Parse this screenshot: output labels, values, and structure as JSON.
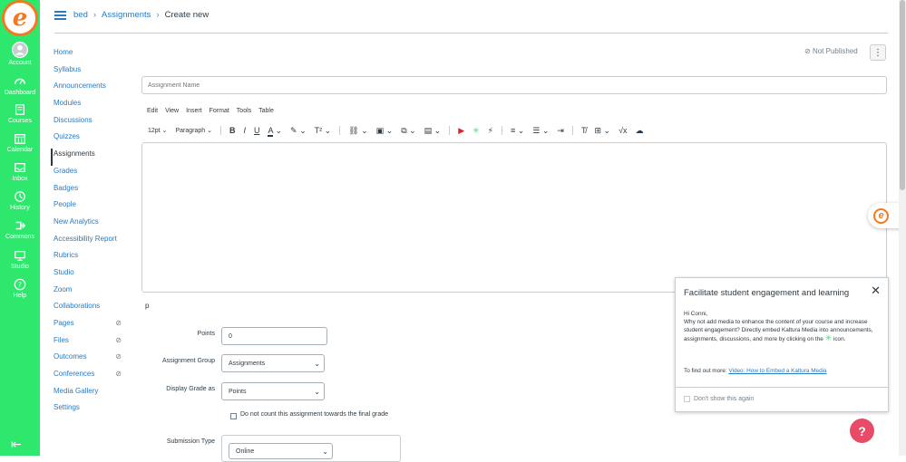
{
  "global_nav": [
    {
      "label": "Account",
      "icon": "account-icon"
    },
    {
      "label": "Dashboard",
      "icon": "dashboard-icon"
    },
    {
      "label": "Courses",
      "icon": "courses-icon"
    },
    {
      "label": "Calendar",
      "icon": "calendar-icon"
    },
    {
      "label": "Inbox",
      "icon": "inbox-icon"
    },
    {
      "label": "History",
      "icon": "history-icon"
    },
    {
      "label": "Commons",
      "icon": "commons-icon"
    },
    {
      "label": "Studio",
      "icon": "studio-icon"
    },
    {
      "label": "Help",
      "icon": "help-icon"
    }
  ],
  "breadcrumb": {
    "course": "bed",
    "section": "Assignments",
    "current": "Create new"
  },
  "course_nav": [
    {
      "label": "Home"
    },
    {
      "label": "Syllabus"
    },
    {
      "label": "Announcements"
    },
    {
      "label": "Modules"
    },
    {
      "label": "Discussions"
    },
    {
      "label": "Quizzes"
    },
    {
      "label": "Assignments",
      "active": true
    },
    {
      "label": "Grades"
    },
    {
      "label": "Badges"
    },
    {
      "label": "People"
    },
    {
      "label": "New Analytics"
    },
    {
      "label": "Accessibility Report"
    },
    {
      "label": "Rubrics"
    },
    {
      "label": "Studio"
    },
    {
      "label": "Zoom"
    },
    {
      "label": "Collaborations"
    },
    {
      "label": "Pages",
      "hidden": true
    },
    {
      "label": "Files",
      "hidden": true
    },
    {
      "label": "Outcomes",
      "hidden": true
    },
    {
      "label": "Conferences",
      "hidden": true
    },
    {
      "label": "Media Gallery"
    },
    {
      "label": "Settings"
    }
  ],
  "status": {
    "published": "Not Published"
  },
  "assignment_name": {
    "placeholder": "Assignment Name",
    "value": ""
  },
  "editor": {
    "menubar": [
      "Edit",
      "View",
      "Insert",
      "Format",
      "Tools",
      "Table"
    ],
    "font_size": "12pt",
    "block_format": "Paragraph",
    "path": "p"
  },
  "fields": {
    "points_label": "Points",
    "points_value": "0",
    "group_label": "Assignment Group",
    "group_value": "Assignments",
    "display_label": "Display Grade as",
    "display_value": "Points",
    "final_grade_label": "Do not count this assignment towards the final grade",
    "submission_label": "Submission Type",
    "submission_value": "Online"
  },
  "popup": {
    "title": "Facilitate student engagement and learning",
    "greeting": "Hi Conni,",
    "body": "Why not add media to enhance the content of your course and increase student engagement? Directly embed Kaltura Media into announcements, assignments, discussions, and more by clicking on the",
    "body_end": "icon.",
    "more_prefix": "To find out more: ",
    "more_link": "Video: How to Embed a Kaltura Media",
    "dont_show": "Don't show this again"
  },
  "colors": {
    "nav_bg": "#2ee86e",
    "link": "#2b7abc",
    "brand": "#f47920",
    "help": "#e94a66"
  }
}
